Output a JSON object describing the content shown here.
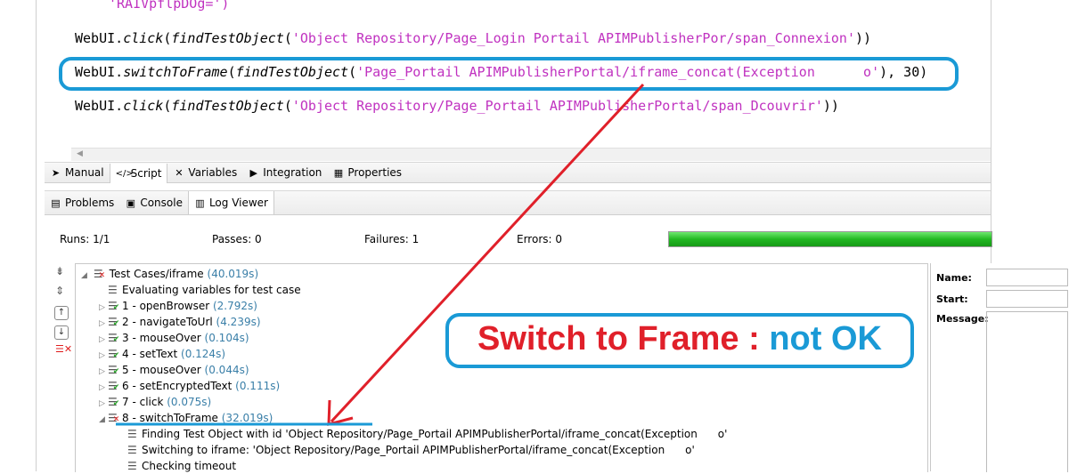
{
  "editor": {
    "line_partial": "'RAIVpflpDOg=')",
    "line1": {
      "obj": "WebUI.",
      "fn": "click",
      "p1": "(",
      "fn2": "findTestObject",
      "p2": "(",
      "str": "'Object Repository/Page_Login Portail APIMPublisherPor/span_Connexion'",
      "end": "))"
    },
    "line2": {
      "obj": "WebUI.",
      "fn": "switchToFrame",
      "p1": "(",
      "fn2": "findTestObject",
      "p2": "(",
      "str": "'Page_Portail APIMPublisherPortal/iframe_concat(Exception      o'",
      "end": "), 30)"
    },
    "line3": {
      "obj": "WebUI.",
      "fn": "click",
      "p1": "(",
      "fn2": "findTestObject",
      "p2": "(",
      "str": "'Object Repository/Page_Portail APIMPublisherPortal/span_Dcouvrir'",
      "end": "))"
    }
  },
  "editor_tabs": [
    {
      "label": "Manual",
      "icon": "manual-icon"
    },
    {
      "label": "Script",
      "icon": "script-icon"
    },
    {
      "label": "Variables",
      "icon": "variables-icon"
    },
    {
      "label": "Integration",
      "icon": "integration-icon"
    },
    {
      "label": "Properties",
      "icon": "properties-icon"
    }
  ],
  "bottom_tabs": [
    {
      "label": "Problems",
      "icon": "problems-icon"
    },
    {
      "label": "Console",
      "icon": "console-icon"
    },
    {
      "label": "Log Viewer",
      "icon": "log-viewer-icon"
    }
  ],
  "stats": {
    "runs": "Runs: 1/1",
    "passes": "Passes: 0",
    "failures": "Failures: 1",
    "errors": "Errors: 0",
    "progress": 1.0,
    "progress_color": "#22b822"
  },
  "tree": {
    "root": {
      "label": "Test Cases/iframe",
      "time": "(40.019s)"
    },
    "items": [
      {
        "label": "Evaluating variables for test case",
        "time": ""
      },
      {
        "label": "1 - openBrowser ",
        "time": "(2.792s)"
      },
      {
        "label": "2 - navigateToUrl ",
        "time": "(4.239s)"
      },
      {
        "label": "3 - mouseOver ",
        "time": "(0.104s)"
      },
      {
        "label": "4 - setText ",
        "time": "(0.124s)"
      },
      {
        "label": "5 - mouseOver ",
        "time": "(0.044s)"
      },
      {
        "label": "6 - setEncryptedText ",
        "time": "(0.111s)"
      },
      {
        "label": "7 - click ",
        "time": "(0.075s)"
      },
      {
        "label": "8 - switchToFrame ",
        "time": "(32.019s)"
      }
    ],
    "children": [
      {
        "label": "Finding Test Object with id 'Object Repository/Page_Portail APIMPublisherPortal/iframe_concat(Exception      o'"
      },
      {
        "label": "Switching to iframe: 'Object Repository/Page_Portail APIMPublisherPortal/iframe_concat(Exception      o'"
      },
      {
        "label": "Checking timeout"
      }
    ]
  },
  "details": {
    "name": "Name:",
    "start": "Start:",
    "message": "Message:"
  },
  "annotation": {
    "part1": "Switch to Frame : ",
    "part2": "not OK",
    "color1": "#e0202a",
    "color2": "#1a9ad6",
    "box_color": "#1a9ad6",
    "arrow_color": "#e0202a"
  }
}
